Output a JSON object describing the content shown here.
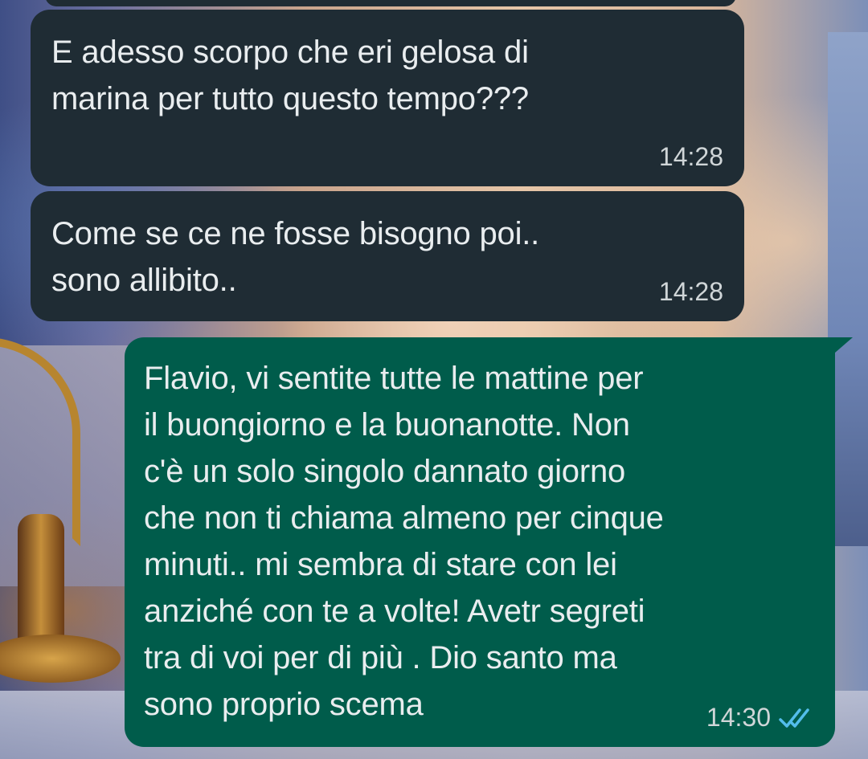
{
  "colors": {
    "incoming_bubble": "#1f2c34",
    "outgoing_bubble": "#005c4b",
    "text": "#e9edef",
    "read_ticks": "#53bdeb"
  },
  "messages": [
    {
      "direction": "incoming",
      "text": "E adesso scorpo che eri gelosa di\nmarina per tutto questo tempo???",
      "time": "14:28"
    },
    {
      "direction": "incoming",
      "text": "Come se ce  ne fosse bisogno poi..\nsono allibito..",
      "time": "14:28"
    },
    {
      "direction": "outgoing",
      "text": "Flavio, vi sentite tutte le mattine per\nil buongiorno e la buonanotte. Non\nc'è un solo singolo dannato giorno\nche non ti chiama almeno per cinque\nminuti.. mi sembra di stare con lei\nanziché con te a volte! Avetr segreti\ntra di voi per di più . Dio santo ma\nsono proprio scema",
      "time": "14:30",
      "status_icon": "double-check-read-icon"
    }
  ]
}
